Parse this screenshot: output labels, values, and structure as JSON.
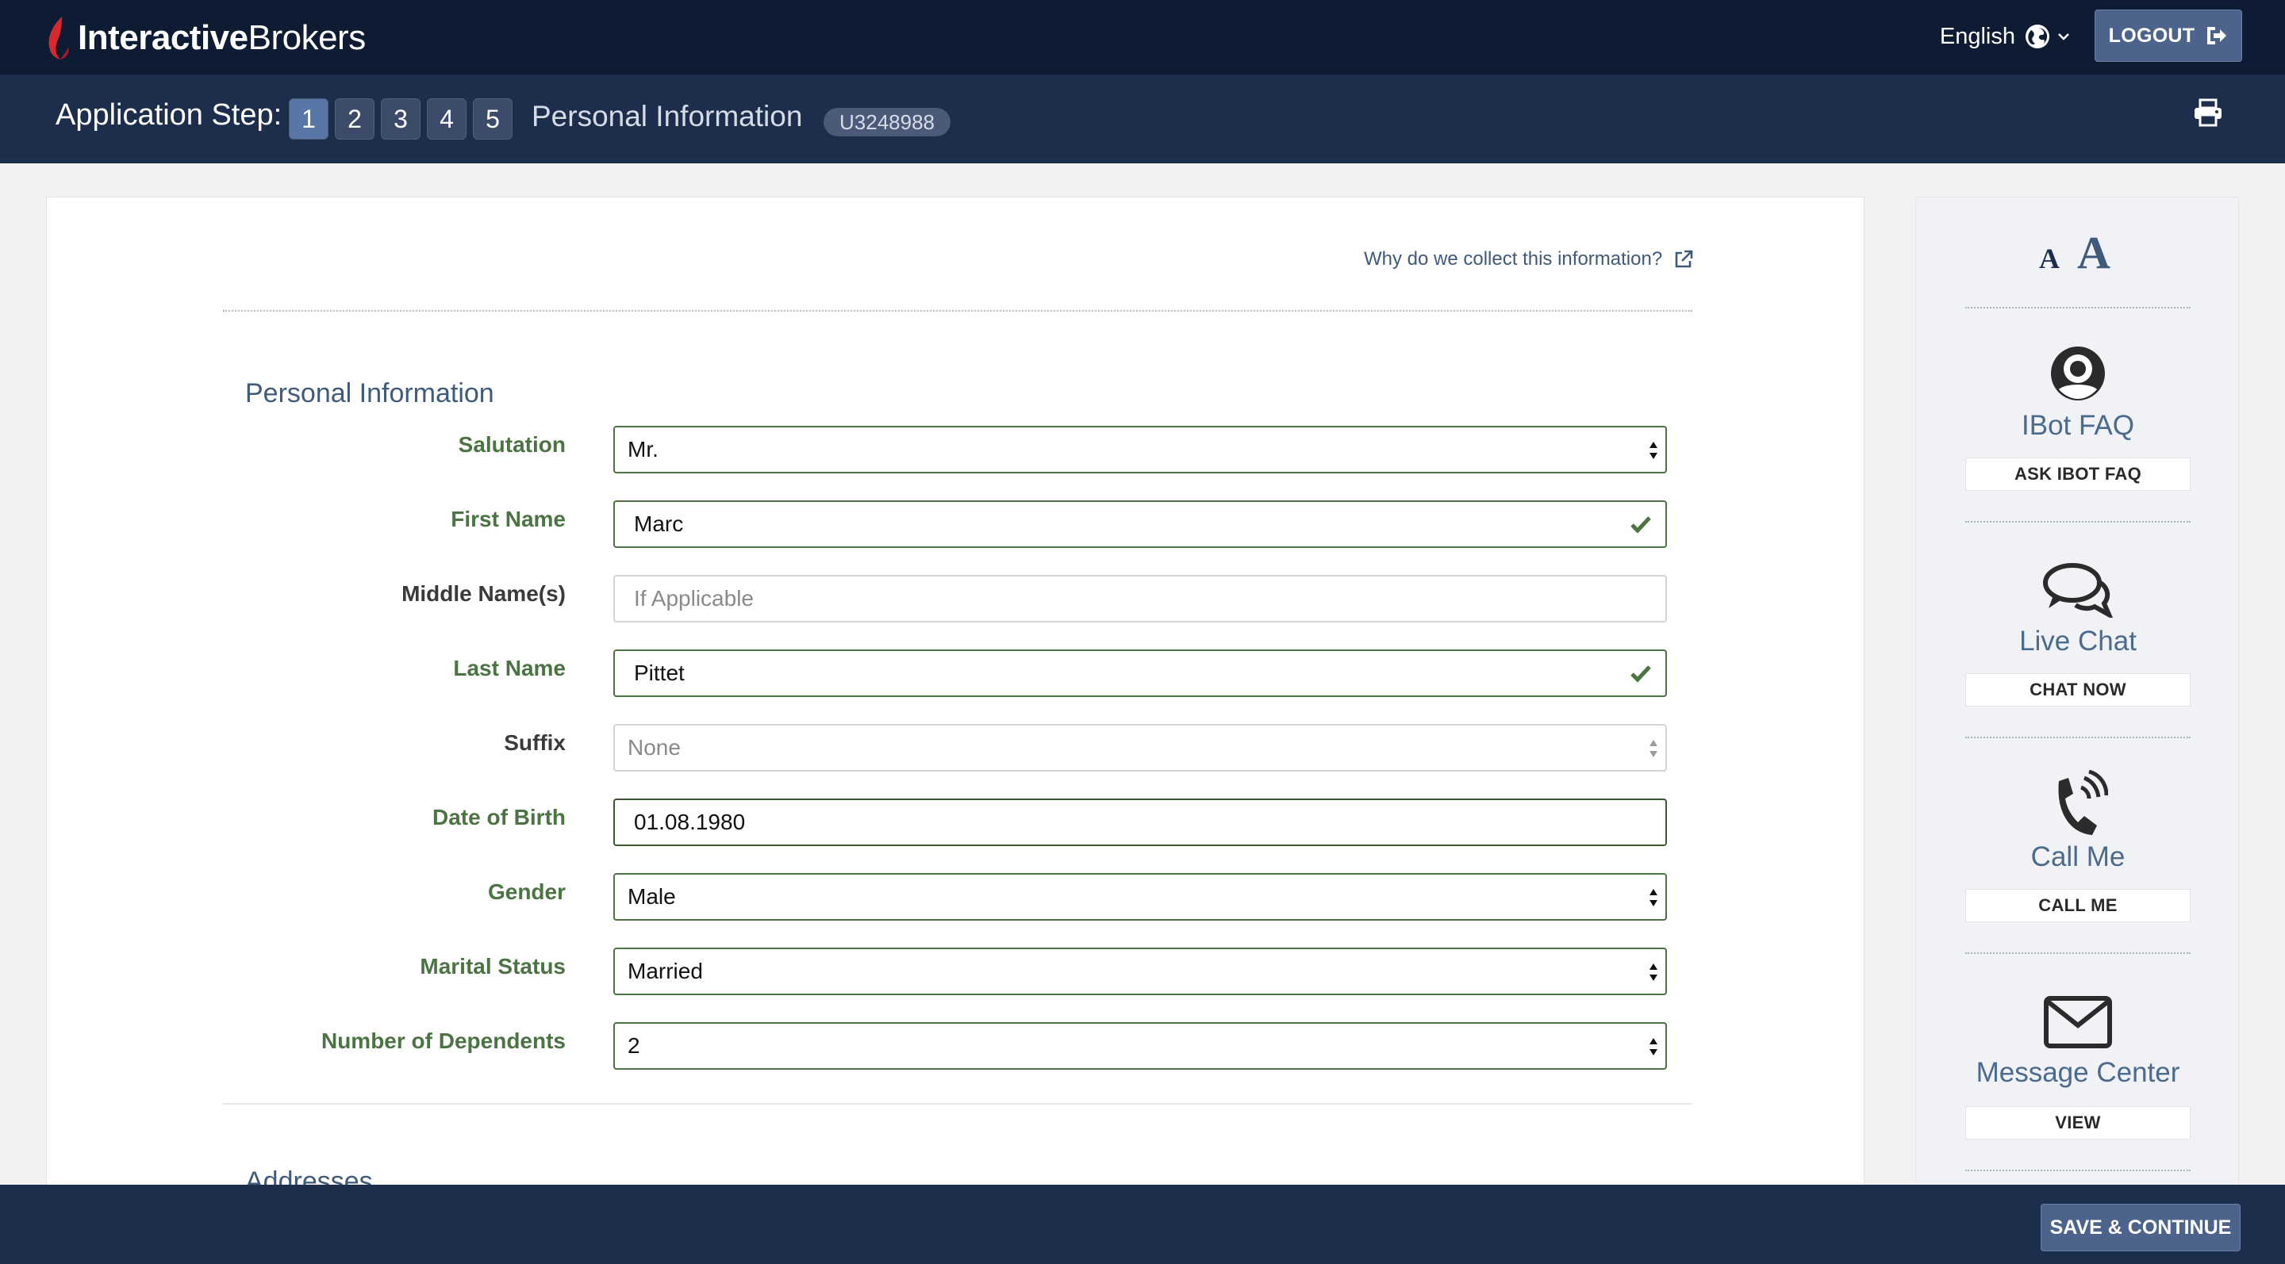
{
  "header": {
    "logo_bold": "Interactive",
    "logo_regular": "Brokers",
    "language": "English",
    "logout_label": "LOGOUT"
  },
  "stepbar": {
    "label": "Application Step:",
    "steps": [
      "1",
      "2",
      "3",
      "4",
      "5"
    ],
    "active_step": "1",
    "title": "Personal Information",
    "account_id": "U3248988"
  },
  "form": {
    "why_link": "Why do we collect this information?",
    "section_title": "Personal Information",
    "fields": {
      "salutation": {
        "label": "Salutation",
        "value": "Mr."
      },
      "first_name": {
        "label": "First Name",
        "value": "Marc"
      },
      "middle_name": {
        "label": "Middle Name(s)",
        "placeholder": "If Applicable"
      },
      "last_name": {
        "label": "Last Name",
        "value": "Pittet"
      },
      "suffix": {
        "label": "Suffix",
        "value": "None"
      },
      "dob": {
        "label": "Date of Birth",
        "value": "01.08.1980"
      },
      "gender": {
        "label": "Gender",
        "value": "Male"
      },
      "marital_status": {
        "label": "Marital Status",
        "value": "Married"
      },
      "dependents": {
        "label": "Number of Dependents",
        "value": "2"
      }
    },
    "next_section_title": "Addresses"
  },
  "sidebar": {
    "font_small": "A",
    "font_large": "A",
    "ibot": {
      "title": "IBot FAQ",
      "button": "ASK IBOT FAQ"
    },
    "chat": {
      "title": "Live Chat",
      "button": "CHAT NOW"
    },
    "call": {
      "title": "Call Me",
      "button": "CALL ME"
    },
    "message": {
      "title": "Message Center",
      "button": "VIEW"
    }
  },
  "footer": {
    "save_label": "SAVE & CONTINUE"
  },
  "colors": {
    "topbar": "#0d1b33",
    "stepbar": "#1d2e4d",
    "valid_green": "#4b7442",
    "accent_blue": "#4c638b",
    "logo_red": "#d7282f"
  }
}
